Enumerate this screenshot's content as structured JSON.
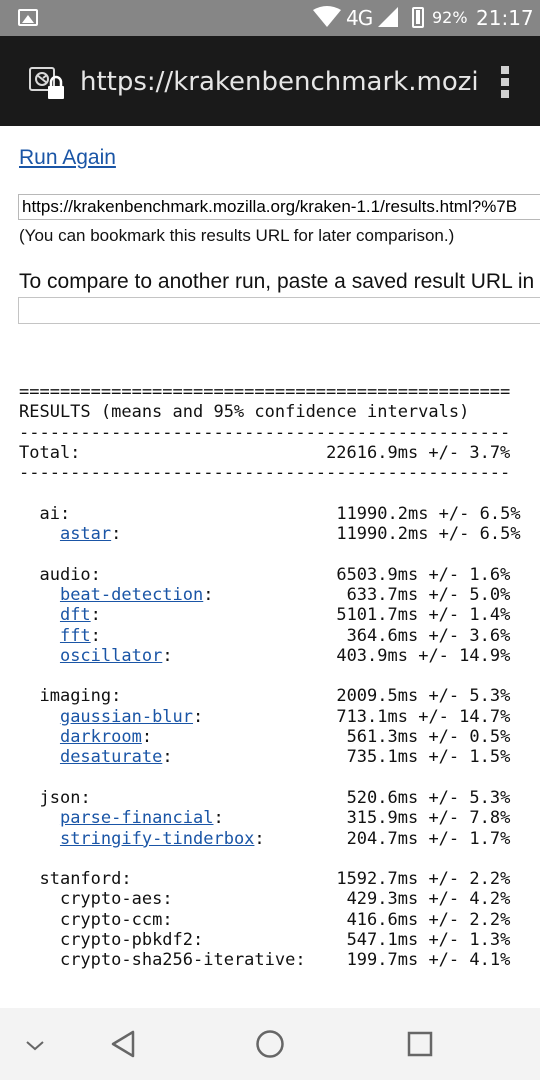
{
  "status_bar": {
    "network": "4G",
    "battery": "92%",
    "time": "21:17"
  },
  "browser": {
    "url": "https://krakenbenchmark.mozil"
  },
  "page": {
    "run_again": "Run Again",
    "results_url": "https://krakenbenchmark.mozilla.org/kraken-1.1/results.html?%7B",
    "bookmark_note": "(You can bookmark this results URL for later comparison.)",
    "compare_text": "To compare to another run, paste a saved result URL in",
    "compare_value": ""
  },
  "results": {
    "rule_top": "================================================",
    "title": "RESULTS (means and 95% confidence intervals)",
    "rule_mid": "------------------------------------------------",
    "total_label": "Total:",
    "total_value": "22616.9ms +/- 3.7%",
    "rule_bottom": "------------------------------------------------",
    "categories": [
      {
        "name": "ai",
        "value": "11990.2ms +/- 6.5%",
        "tests": [
          {
            "name": "astar",
            "value": "11990.2ms +/- 6.5%",
            "link": true
          }
        ]
      },
      {
        "name": "audio",
        "value": "6503.9ms +/- 1.6%",
        "tests": [
          {
            "name": "beat-detection",
            "value": "633.7ms +/- 5.0%",
            "link": true
          },
          {
            "name": "dft",
            "value": "5101.7ms +/- 1.4%",
            "link": true
          },
          {
            "name": "fft",
            "value": "364.6ms +/- 3.6%",
            "link": true
          },
          {
            "name": "oscillator",
            "value": "403.9ms +/- 14.9%",
            "link": true
          }
        ]
      },
      {
        "name": "imaging",
        "value": "2009.5ms +/- 5.3%",
        "tests": [
          {
            "name": "gaussian-blur",
            "value": "713.1ms +/- 14.7%",
            "link": true
          },
          {
            "name": "darkroom",
            "value": "561.3ms +/- 0.5%",
            "link": true
          },
          {
            "name": "desaturate",
            "value": "735.1ms +/- 1.5%",
            "link": true
          }
        ]
      },
      {
        "name": "json",
        "value": "520.6ms +/- 5.3%",
        "tests": [
          {
            "name": "parse-financial",
            "value": "315.9ms +/- 7.8%",
            "link": true
          },
          {
            "name": "stringify-tinderbox",
            "value": "204.7ms +/- 1.7%",
            "link": true
          }
        ]
      },
      {
        "name": "stanford",
        "value": "1592.7ms +/- 2.2%",
        "tests": [
          {
            "name": "crypto-aes",
            "value": "429.3ms +/- 4.2%",
            "link": false
          },
          {
            "name": "crypto-ccm",
            "value": "416.6ms +/- 2.2%",
            "link": false
          },
          {
            "name": "crypto-pbkdf2",
            "value": "547.1ms +/- 1.3%",
            "link": false
          },
          {
            "name": "crypto-sha256-iterative",
            "value": "199.7ms +/- 4.1%",
            "link": false
          }
        ]
      }
    ]
  },
  "nav_bar": {
    "icons": [
      "chevron-down-icon",
      "back-icon",
      "home-icon",
      "recents-icon"
    ]
  }
}
